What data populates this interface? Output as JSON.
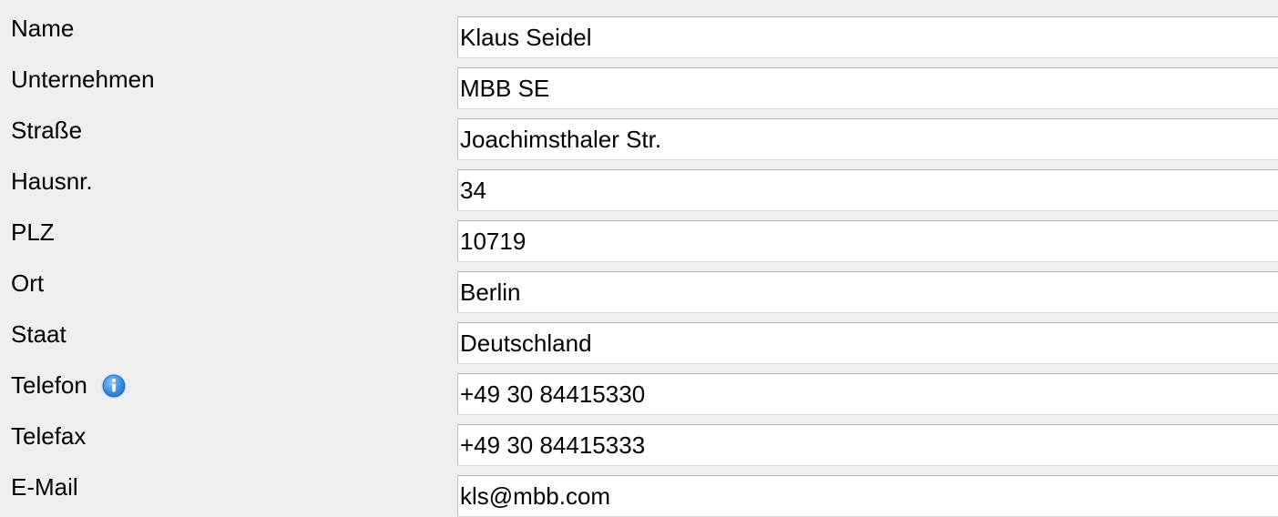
{
  "form": {
    "fields": [
      {
        "id": "name",
        "label": "Name",
        "value": "Klaus Seidel"
      },
      {
        "id": "company",
        "label": "Unternehmen",
        "value": "MBB SE"
      },
      {
        "id": "street",
        "label": "Straße",
        "value": "Joachimsthaler Str."
      },
      {
        "id": "house-number",
        "label": "Hausnr.",
        "value": "34"
      },
      {
        "id": "zip",
        "label": "PLZ",
        "value": "10719"
      },
      {
        "id": "city",
        "label": "Ort",
        "value": "Berlin"
      },
      {
        "id": "country",
        "label": "Staat",
        "value": "Deutschland"
      },
      {
        "id": "phone",
        "label": "Telefon",
        "value": "+49 30 84415330",
        "info_icon": "info-icon"
      },
      {
        "id": "fax",
        "label": "Telefax",
        "value": "+49 30 84415333"
      },
      {
        "id": "email",
        "label": "E-Mail",
        "value": "kls@mbb.com"
      }
    ]
  },
  "colors": {
    "page_background": "#efefef",
    "field_background": "#ffffff",
    "field_border": "#b8b8b8",
    "info_icon_fill": "#4a90d9"
  }
}
